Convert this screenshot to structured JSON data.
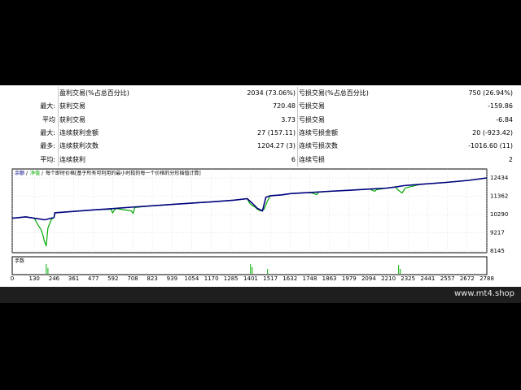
{
  "stats": {
    "rows": [
      {
        "label": "",
        "name": "盈利交易(%占总百分比)",
        "value": "2034 (73.06%)",
        "name2": "亏损交易(%占总百分比)",
        "value2": "750 (26.94%)"
      },
      {
        "label": "最大:",
        "name": "获利交易",
        "value": "720.48",
        "name2": "亏损交易",
        "value2": "-159.86"
      },
      {
        "label": "平均",
        "name": "获利交易",
        "value": "3.73",
        "name2": "亏损交易",
        "value2": "-6.84"
      },
      {
        "label": "最大:",
        "name": "连续获利金额",
        "value": "27 (157.11)",
        "name2": "连续亏损金额",
        "value2": "20 (-923.42)"
      },
      {
        "label": "最多:",
        "name": "连续获利次数",
        "value": "1204.27 (3)",
        "name2": "连续亏损次数",
        "value2": "-1016.60 (11)"
      },
      {
        "label": "平均:",
        "name": "连续获利",
        "value": "6",
        "name2": "连续亏损",
        "value2": "2"
      }
    ]
  },
  "chart_data": {
    "type": "line",
    "legend": {
      "balance_label": "余额",
      "equity_label": "净值",
      "description": "每个即时价格[基于所有可利用的最小时段的每一个价格的分形插值计算]"
    },
    "volume_label": "手数",
    "yticks": [
      12434,
      11362,
      10290,
      9217,
      8145
    ],
    "ylim": [
      8145,
      12434
    ],
    "xticks": [
      0,
      130,
      246,
      361,
      477,
      592,
      708,
      823,
      939,
      1054,
      1170,
      1285,
      1401,
      1517,
      1632,
      1748,
      1863,
      1979,
      2094,
      2210,
      2325,
      2441,
      2557,
      2672,
      2788
    ],
    "xlim": [
      0,
      2788
    ],
    "grid": true,
    "colors": {
      "balance": "#000080",
      "equity": "#00aa00",
      "volume": "#00aa00",
      "grid": "#c0c0c0",
      "frame": "#000000"
    },
    "balance": {
      "x": [
        0,
        80,
        130,
        190,
        200,
        246,
        250,
        360,
        480,
        600,
        700,
        820,
        940,
        1060,
        1180,
        1300,
        1380,
        1405,
        1440,
        1470,
        1480,
        1490,
        1517,
        1580,
        1640,
        1750,
        1860,
        1980,
        2100,
        2200,
        2250,
        2300,
        2400,
        2550,
        2680,
        2788
      ],
      "y": [
        10070,
        10150,
        10070,
        9980,
        10000,
        10120,
        10390,
        10470,
        10560,
        10640,
        10720,
        10800,
        10880,
        10960,
        11040,
        11130,
        11220,
        11000,
        10650,
        10500,
        10900,
        11300,
        11390,
        11440,
        11520,
        11580,
        11650,
        11710,
        11780,
        11840,
        11900,
        11980,
        12060,
        12170,
        12290,
        12434
      ]
    },
    "equity": {
      "x": [
        0,
        80,
        130,
        150,
        170,
        180,
        190,
        200,
        210,
        230,
        246,
        250,
        360,
        480,
        580,
        590,
        600,
        610,
        700,
        710,
        720,
        820,
        940,
        1060,
        1180,
        1300,
        1380,
        1395,
        1405,
        1430,
        1440,
        1460,
        1480,
        1500,
        1517,
        1580,
        1640,
        1750,
        1790,
        1800,
        1860,
        1980,
        2100,
        2130,
        2140,
        2200,
        2250,
        2270,
        2290,
        2310,
        2400,
        2550,
        2680,
        2788
      ],
      "y": [
        10070,
        10150,
        10070,
        9700,
        9400,
        9100,
        8700,
        8450,
        9500,
        10000,
        10120,
        10390,
        10470,
        10560,
        10600,
        10380,
        10550,
        10640,
        10500,
        10350,
        10700,
        10800,
        10880,
        10960,
        11040,
        11130,
        11220,
        10950,
        10850,
        10700,
        10600,
        10500,
        10600,
        11100,
        11390,
        11440,
        11520,
        11580,
        11450,
        11600,
        11650,
        11710,
        11780,
        11650,
        11750,
        11840,
        11900,
        11700,
        11550,
        11850,
        12060,
        12170,
        12290,
        12434
      ]
    },
    "volume": {
      "x": [
        200,
        210,
        1400,
        1410,
        1500,
        2270,
        2280
      ],
      "y": [
        1.0,
        0.6,
        1.0,
        0.7,
        0.5,
        0.9,
        0.5
      ]
    }
  }
}
